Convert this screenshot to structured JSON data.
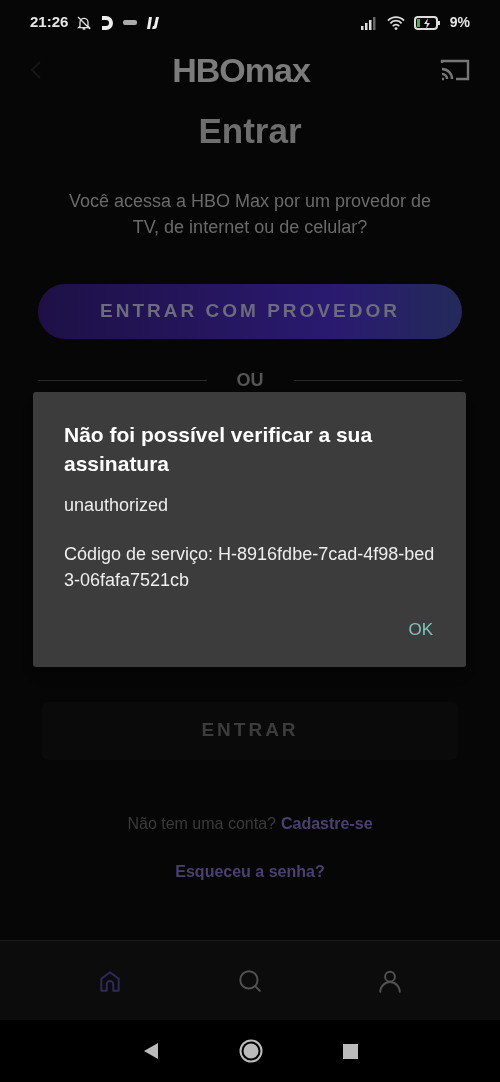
{
  "status_bar": {
    "time": "21:26",
    "battery": "9%"
  },
  "header": {
    "logo": "HBOmax"
  },
  "title": "Entrar",
  "subtitle": "Você acessa a HBO Max por um provedor de TV, de internet ou de celular?",
  "provider_button": "ENTRAR COM PROVEDOR",
  "divider": "OU",
  "dialog": {
    "title": "Não foi possível verificar a sua assinatura",
    "message": "unauthorized",
    "code": "Código de serviço: H-8916fdbe-7cad-4f98-bed3-06fafa7521cb",
    "button": "OK"
  },
  "login_button": {
    "label": "ENTRAR",
    "disabled": true
  },
  "signup": {
    "prompt": "Não tem uma conta?",
    "link": "Cadastre-se"
  },
  "forgot_link": "Esqueceu a senha?",
  "bottom_nav": [
    {
      "kind": "home",
      "selected": true
    },
    {
      "kind": "search",
      "selected": false
    },
    {
      "kind": "profile",
      "selected": false
    }
  ]
}
